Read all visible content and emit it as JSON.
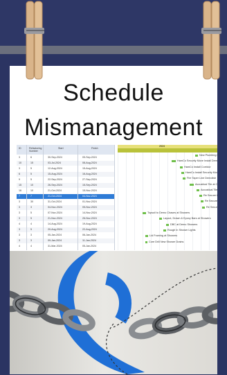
{
  "title": {
    "line1": "Schedule",
    "line2": "Mismanagement"
  },
  "spreadsheet": {
    "headers": [
      "ID",
      "Refactoring Number",
      "Start",
      "Finish"
    ],
    "rows": [
      [
        "3",
        "6",
        "30-Sep-2024",
        "05-Sep-2024"
      ],
      [
        "10",
        "15",
        "03-Jul-2024",
        "08-Aug-2024"
      ],
      [
        "3",
        "5",
        "12-Aug-2024",
        "15-Aug-2024"
      ],
      [
        "6",
        "5",
        "15-Aug-2024",
        "16-Aug-2024"
      ],
      [
        "9",
        "5",
        "22-Sep-2024",
        "27-Sep-2024"
      ],
      [
        "15",
        "10",
        "26-Sep-2024",
        "15-Sep-2024"
      ],
      [
        "16",
        "10",
        "21-Oct-2024",
        "15-Nov-2024"
      ],
      [
        "7",
        "7",
        "21-Oct-2024",
        "04-Nov-2024"
      ],
      [
        "3",
        "30",
        "31-Oct-2024",
        "01-Nov-2024"
      ],
      [
        "3",
        "3",
        "04-Nov-2024",
        "05-Nov-2024"
      ],
      [
        "3",
        "5",
        "07-Nov-2024",
        "14-Nov-2024"
      ],
      [
        "3",
        "5",
        "21-Nov-2024",
        "26-Nov-2024"
      ],
      [
        "4",
        "4",
        "14-Aug-2024",
        "19-Aug-2024"
      ],
      [
        "3",
        "5",
        "20-Aug-2024",
        "22-Aug-2024"
      ],
      [
        "3",
        "3",
        "05-Jan-2024",
        "06-Jan-2024"
      ],
      [
        "3",
        "3",
        "09-Jan-2024",
        "11-Jan-2024"
      ],
      [
        "4",
        "4",
        "31-Mar-2024",
        "05-Jan-2024"
      ]
    ],
    "highlighted_row": 7
  },
  "gantt": {
    "header_label": "2024",
    "tasks": [
      "New Plumbing Fixtures",
      "HamCo Security Move Install Demonstration",
      "HamCo Install Corridor",
      "HamCo Install Security Move - Floor",
      "Fire Taper Line Demolish",
      "Acoustical Tile at Ceilings",
      "Acoustical Tile at Cat",
      "Re Secure Lighting",
      "Re Secure Light",
      "Re Secure Light",
      "Topsoil to Demo Chases at Showers",
      "Layout, Drawn & Epoxy Bars at Showers",
      "DBC at Demo Showers",
      "Rough In Shower Lights",
      "Lid Framing at Showers",
      "Core Drill New Shower Drains"
    ]
  },
  "photo": {
    "description_icon": "broken-chain-icon"
  },
  "colors": {
    "background": "#2b3462",
    "accent_blue": "#1f6fd6",
    "clip_wood": "#d9b48a"
  }
}
